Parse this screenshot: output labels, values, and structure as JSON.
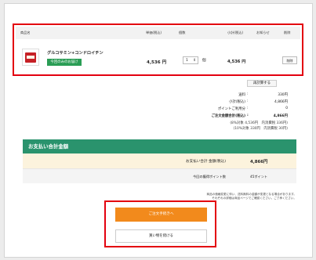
{
  "cart": {
    "headers": {
      "product": "商品名",
      "unit_price": "単価(税込)",
      "quantity": "個数",
      "subtotal": "小計(税込)",
      "notice": "お知らせ",
      "delete": "削除"
    },
    "item": {
      "name": "グルコサミン+コンドロイチン",
      "badge": "今回のみのお届け",
      "price": "4,536 円",
      "qty": "1",
      "qty_unit": "個",
      "subtotal": "4,536 円",
      "delete_label": "削除"
    },
    "recalc_label": "再計算する"
  },
  "summary": {
    "rows": [
      {
        "label": "送料",
        "value": "330円"
      },
      {
        "label": "小計(税込)",
        "value": "4,866円"
      },
      {
        "label": "ポイントご利用分",
        "value": "0"
      },
      {
        "label": "ご注文金額合計(税込)",
        "value": "4,866円"
      }
    ],
    "tax_lines": [
      "(8%対象 4,536円　内消費税 336円)",
      "(10%対象 330円　内消費税 30円)"
    ]
  },
  "payment": {
    "title": "お支払い合計金額",
    "total_label": "お支払い合計 金額(税込)",
    "total_value": "4,866円",
    "points_label": "今回の獲得ポイント数",
    "points_value": "45ポイント"
  },
  "note": [
    "商品の価格変更に伴い、送料無料の金額が変更となる場合があります。",
    "それぞれの詳細は商品ページでご確認ください。ご了承ください。"
  ],
  "buttons": {
    "checkout": "ご注文手続きへ",
    "continue": "買い物を続ける"
  }
}
